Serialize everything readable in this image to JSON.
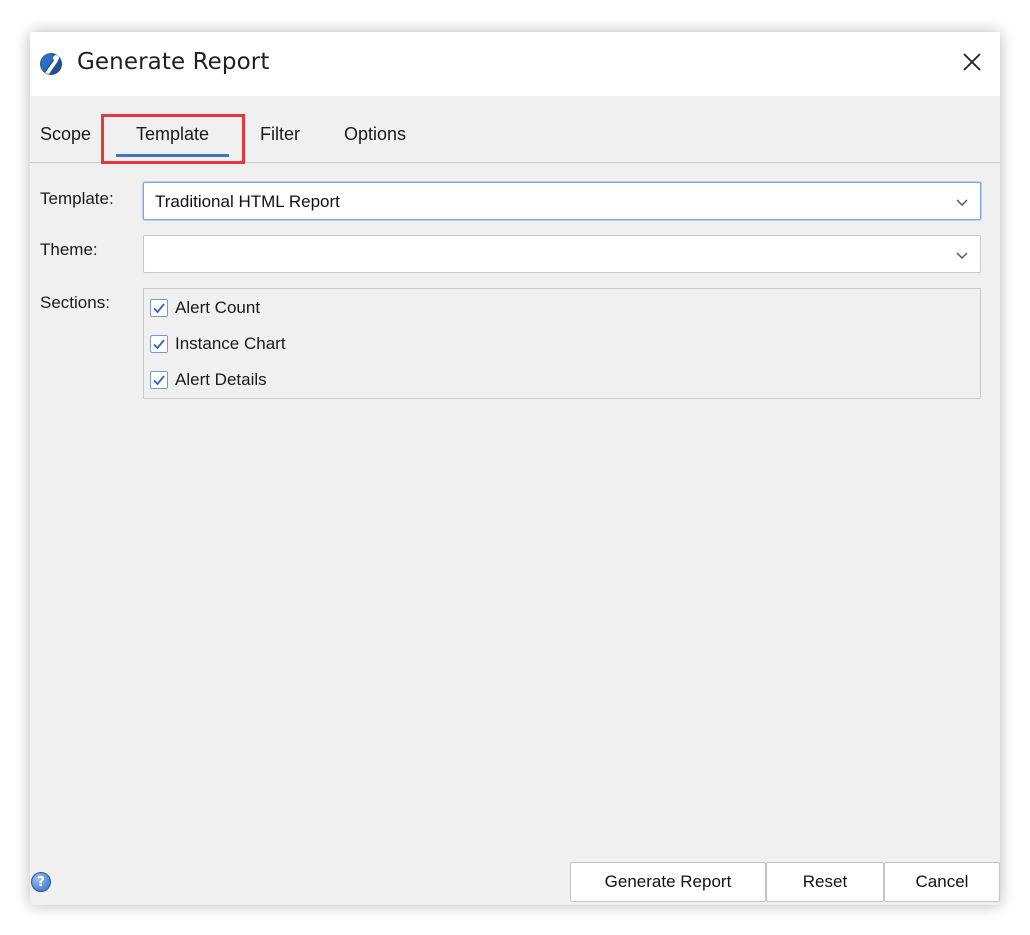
{
  "window": {
    "title": "Generate Report",
    "icon": "app-logo-icon",
    "close_icon": "close-icon"
  },
  "tabs": [
    {
      "label": "Scope"
    },
    {
      "label": "Template",
      "selected": true,
      "highlighted": true
    },
    {
      "label": "Filter"
    },
    {
      "label": "Options"
    }
  ],
  "form": {
    "template_label": "Template:",
    "template_value": "Traditional HTML Report",
    "theme_label": "Theme:",
    "theme_value": "",
    "sections_label": "Sections:",
    "sections": [
      {
        "label": "Alert Count",
        "checked": true
      },
      {
        "label": "Instance Chart",
        "checked": true
      },
      {
        "label": "Alert Details",
        "checked": true
      }
    ]
  },
  "footer": {
    "help_icon": "help-icon",
    "help_glyph": "?",
    "generate_label": "Generate Report",
    "reset_label": "Reset",
    "cancel_label": "Cancel"
  },
  "colors": {
    "accent": "#3c74c6",
    "highlight": "#e8373a",
    "dialog_bg": "#f0f0f0"
  }
}
